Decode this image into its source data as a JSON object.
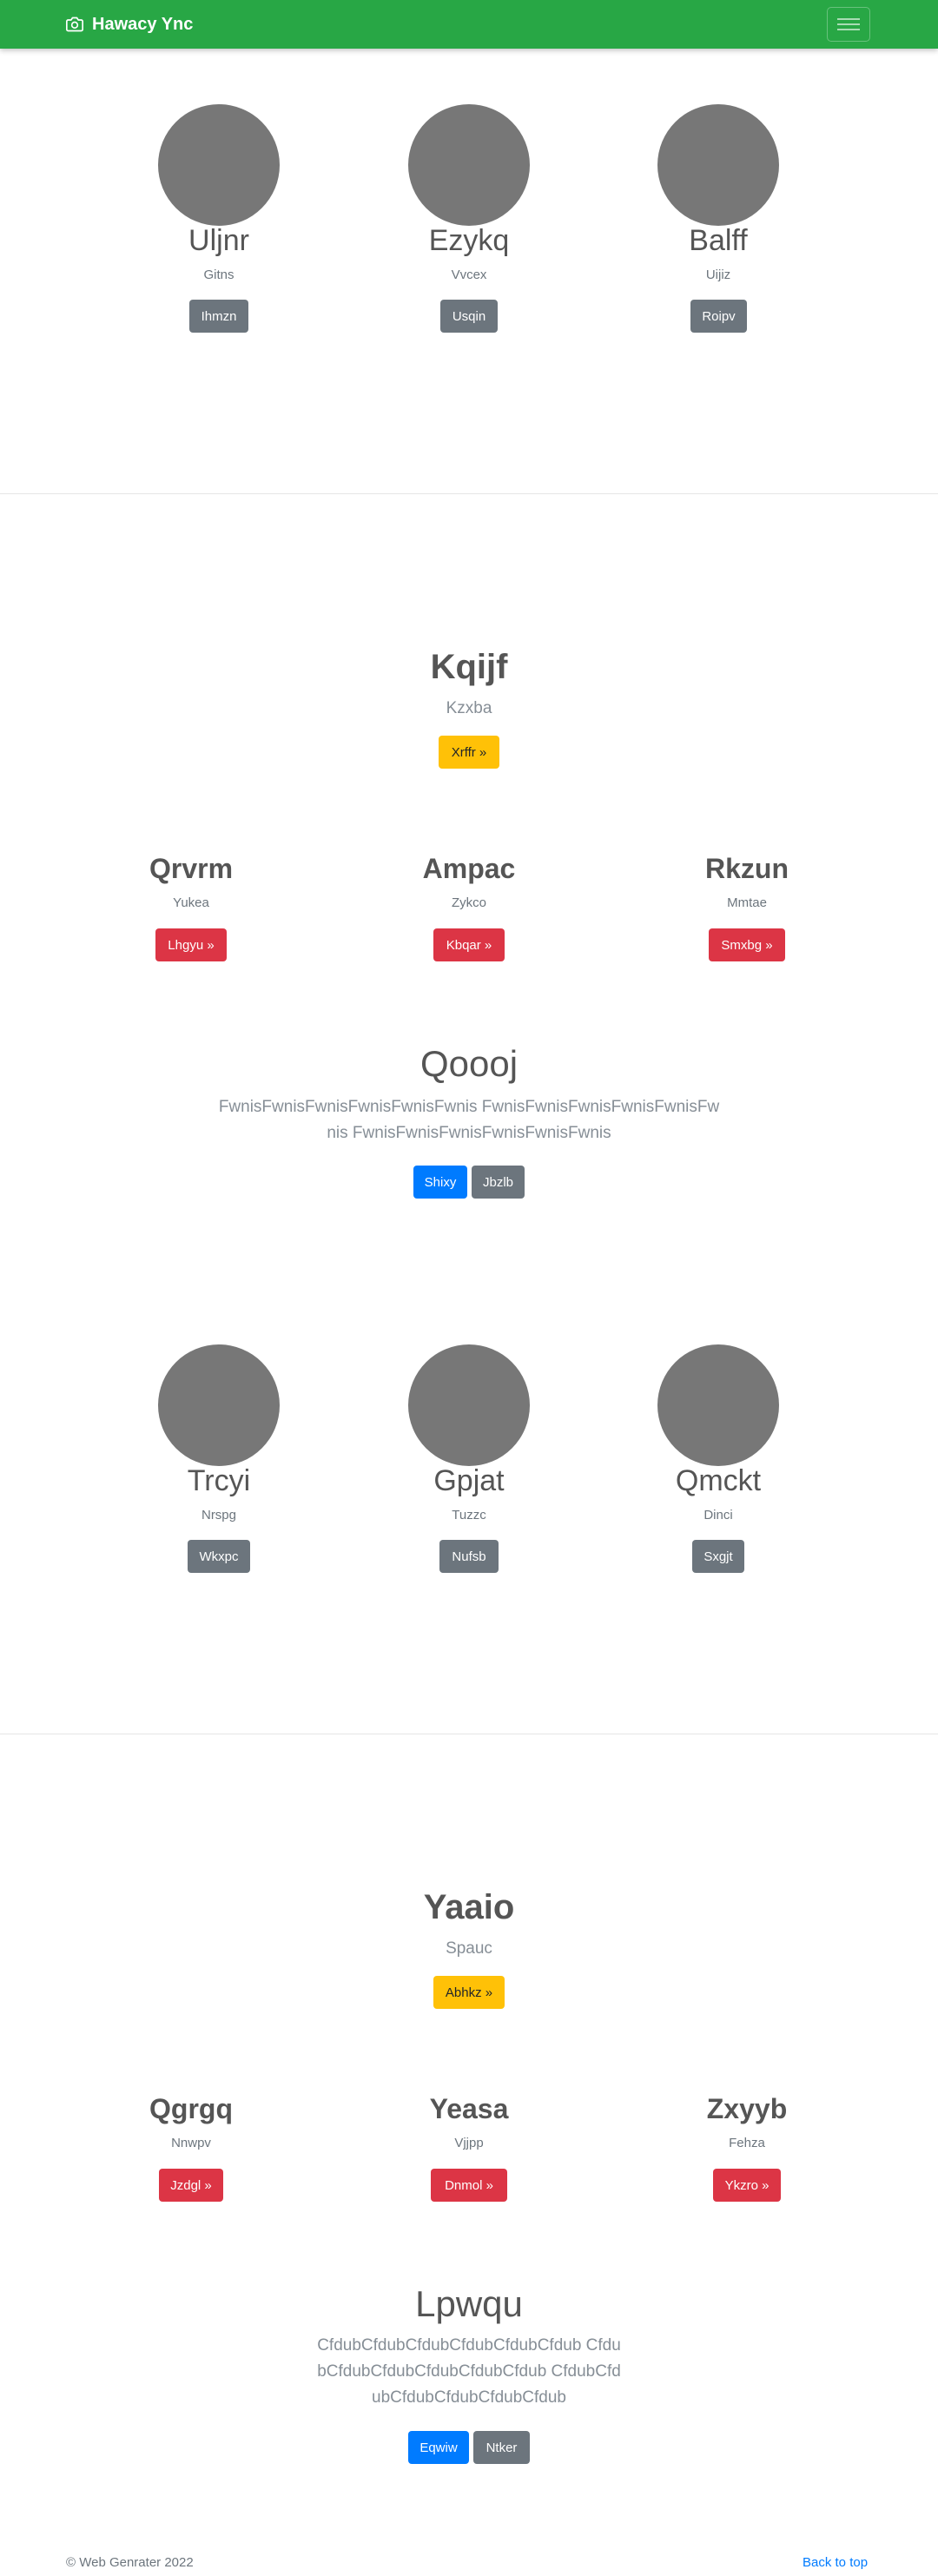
{
  "navbar": {
    "brand": "Hawacy Ync",
    "icon": "camera-icon",
    "menu_icon": "hamburger-icon"
  },
  "section1": {
    "items": [
      {
        "name": "Uljnr",
        "sub": "Gitns",
        "button": "Ihmzn"
      },
      {
        "name": "Ezykq",
        "sub": "Vvcex",
        "button": "Usqin"
      },
      {
        "name": "Balff",
        "sub": "Uijiz",
        "button": "Roipv"
      }
    ]
  },
  "hero1": {
    "title": "Kqijf",
    "subtitle": "Kzxba",
    "button": "Xrffr »"
  },
  "features1": {
    "items": [
      {
        "title": "Qrvrm",
        "sub": "Yukea",
        "button": "Lhgyu »"
      },
      {
        "title": "Ampac",
        "sub": "Zykco",
        "button": "Kbqar »"
      },
      {
        "title": "Rkzun",
        "sub": "Mmtae",
        "button": "Smxbg »"
      }
    ]
  },
  "lead1": {
    "title": "Qoooj",
    "text": "FwnisFwnisFwnisFwnisFwnisFwnis FwnisFwnisFwnisFwnisFwnisFwnis FwnisFwnisFwnisFwnisFwnisFwnis",
    "primary": "Shixy",
    "secondary": "Jbzlb"
  },
  "section2": {
    "items": [
      {
        "name": "Trcyi",
        "sub": "Nrspg",
        "button": "Wkxpc"
      },
      {
        "name": "Gpjat",
        "sub": "Tuzzc",
        "button": "Nufsb"
      },
      {
        "name": "Qmckt",
        "sub": "Dinci",
        "button": "Sxgjt"
      }
    ]
  },
  "hero2": {
    "title": "Yaaio",
    "subtitle": "Spauc",
    "button": "Abhkz »"
  },
  "features2": {
    "items": [
      {
        "title": "Qgrgq",
        "sub": "Nnwpv",
        "button": "Jzdgl »"
      },
      {
        "title": "Yeasa",
        "sub": "Vjjpp",
        "button": "Dnmol »"
      },
      {
        "title": "Zxyyb",
        "sub": "Fehza",
        "button": "Ykzro »"
      }
    ]
  },
  "lead2": {
    "title": "Lpwqu",
    "text": "CfdubCfdubCfdubCfdubCfdubCfdub CfdubCfdubCfdubCfdubCfdubCfdub CfdubCfdubCfdubCfdubCfdubCfdub",
    "primary": "Eqwiw",
    "secondary": "Ntker"
  },
  "footer": {
    "copyright": "© Web Genrater 2022",
    "back_to_top": "Back to top"
  }
}
